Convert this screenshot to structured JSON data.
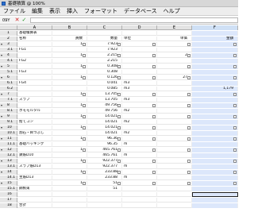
{
  "window": {
    "title": "基礎積算  @ 100%"
  },
  "menu": [
    "ファイル",
    "編集",
    "表示",
    "挿入",
    "フォーマット",
    "データベース",
    "ヘルプ"
  ],
  "formula": {
    "cell_ref": "09Y"
  },
  "columns": [
    "A",
    "B",
    "C",
    "D",
    "E",
    "F"
  ],
  "selected_column": "F",
  "rows": [
    {
      "hdr": "1",
      "a": "基礎積算表",
      "b": "",
      "c": "",
      "d": "",
      "e": "",
      "f": ""
    },
    {
      "hdr": "2",
      "a": "名称",
      "b": "員数",
      "c": "数量",
      "d": "単位",
      "e": "単価",
      "f": "金額"
    },
    {
      "hdr": "3",
      "a": "",
      "b": "1",
      "c": "7.923",
      "d": "",
      "e": "",
      "f": ""
    },
    {
      "hdr": "3.1",
      "a": "FG1",
      "b": "",
      "c": "7.923",
      "d": "",
      "e": "",
      "f": ""
    },
    {
      "hdr": "4",
      "a": "",
      "b": "1",
      "c": "2.215",
      "d": "",
      "e": "2",
      "f": ""
    },
    {
      "hdr": "4.1",
      "a": "FG2",
      "b": "",
      "c": "2.215",
      "d": "",
      "e": "",
      "f": ""
    },
    {
      "hdr": "5",
      "a": "",
      "b": "1",
      "c": "0.308",
      "d": "",
      "e": "",
      "f": ""
    },
    {
      "hdr": "5.1",
      "a": "FG3",
      "b": "",
      "c": "0.308",
      "d": "",
      "e": "",
      "f": ""
    },
    {
      "hdr": "6",
      "a": "",
      "b": "1",
      "c": "0.126",
      "d": "",
      "e": "27",
      "f": ""
    },
    {
      "hdr": "6.1",
      "a": "FG4",
      "b": "",
      "c": "0.041",
      "d": "m3",
      "e": "",
      "f": ""
    },
    {
      "hdr": "6.2",
      "a": "",
      "b": "",
      "c": "0.085",
      "d": "m3",
      "e": "",
      "f": "1,179"
    },
    {
      "hdr": "7",
      "a": "",
      "b": "1",
      "c": "13.705",
      "d": "",
      "e": "",
      "f": ""
    },
    {
      "hdr": "7.1",
      "a": "スラブ",
      "b": "",
      "c": "13.705",
      "d": "m3",
      "e": "",
      "f": ""
    },
    {
      "hdr": "8",
      "a": "",
      "b": "1",
      "c": "49.756",
      "d": "",
      "e": "",
      "f": ""
    },
    {
      "hdr": "8.1",
      "a": "ホモモルタル",
      "b": "",
      "c": "49.756",
      "d": "m2",
      "e": "",
      "f": ""
    },
    {
      "hdr": "9",
      "a": "",
      "b": "1",
      "c": "14.021",
      "d": "",
      "e": "",
      "f": ""
    },
    {
      "hdr": "9.1",
      "a": "捨てコン",
      "b": "",
      "c": "14.021",
      "d": "m2",
      "e": "",
      "f": ""
    },
    {
      "hdr": "10",
      "a": "",
      "b": "1",
      "c": "14.021",
      "d": "",
      "e": "",
      "f": ""
    },
    {
      "hdr": "10.1",
      "a": "割石・目つぶし",
      "b": "",
      "c": "14.021",
      "d": "m2",
      "e": "",
      "f": ""
    },
    {
      "hdr": "11",
      "a": "",
      "b": "1",
      "c": "96.36",
      "d": "",
      "e": "",
      "f": ""
    },
    {
      "hdr": "11.1",
      "a": "基礎バッキング",
      "b": "",
      "c": "96.35",
      "d": "m",
      "e": "",
      "f": ""
    },
    {
      "hdr": "12",
      "a": "",
      "b": "1",
      "c": "465.761",
      "d": "",
      "e": "",
      "f": ""
    },
    {
      "hdr": "12.1",
      "a": "鉄筋D10",
      "b": "",
      "c": "465.761",
      "d": "m",
      "e": "",
      "f": ""
    },
    {
      "hdr": "13",
      "a": "",
      "b": "1",
      "c": "922.377",
      "d": "",
      "e": "",
      "f": ""
    },
    {
      "hdr": "13.1",
      "a": "スラブ筋D13",
      "b": "",
      "c": "922.377",
      "d": "m",
      "e": "",
      "f": ""
    },
    {
      "hdr": "14",
      "a": "",
      "b": "1",
      "c": "233.88",
      "d": "",
      "e": "",
      "f": ""
    },
    {
      "hdr": "14.1",
      "a": "主筋D13",
      "b": "",
      "c": "233.88",
      "d": "m",
      "e": "",
      "f": ""
    },
    {
      "hdr": "15",
      "a": "",
      "b": "1",
      "c": "51",
      "d": "",
      "e": "",
      "f": ""
    },
    {
      "hdr": "15.1",
      "a": "鋼製束",
      "b": "",
      "c": "51",
      "d": "",
      "e": "",
      "f": ""
    },
    {
      "hdr": "16",
      "a": "",
      "b": "",
      "c": "",
      "d": "",
      "e": "",
      "f": ""
    },
    {
      "hdr": "17",
      "a": "",
      "b": "",
      "c": "",
      "d": "",
      "e": "",
      "f": ""
    },
    {
      "hdr": "18",
      "a": "合計",
      "b": "",
      "c": "",
      "d": "",
      "e": "",
      "f": ""
    }
  ]
}
